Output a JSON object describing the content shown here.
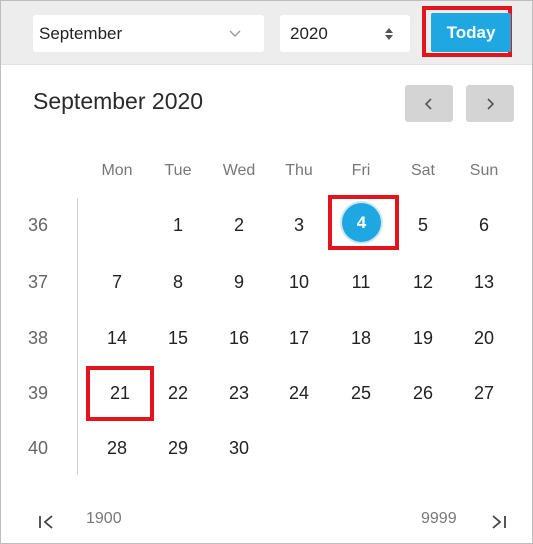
{
  "toolbar": {
    "month_value": "September",
    "year_value": "2020",
    "today_label": "Today"
  },
  "header": {
    "title": "September 2020"
  },
  "weekdays": [
    "Mon",
    "Tue",
    "Wed",
    "Thu",
    "Fri",
    "Sat",
    "Sun"
  ],
  "weeks": [
    {
      "number": "36",
      "days": [
        "",
        "1",
        "2",
        "3",
        "4",
        "5",
        "6"
      ]
    },
    {
      "number": "37",
      "days": [
        "7",
        "8",
        "9",
        "10",
        "11",
        "12",
        "13"
      ]
    },
    {
      "number": "38",
      "days": [
        "14",
        "15",
        "16",
        "17",
        "18",
        "19",
        "20"
      ]
    },
    {
      "number": "39",
      "days": [
        "21",
        "22",
        "23",
        "24",
        "25",
        "26",
        "27"
      ]
    },
    {
      "number": "40",
      "days": [
        "28",
        "29",
        "30",
        "",
        "",
        "",
        ""
      ]
    }
  ],
  "selected_day": "4",
  "today_day": "21",
  "footer": {
    "min_year": "1900",
    "max_year": "9999"
  },
  "colors": {
    "accent": "#1ea7e1",
    "highlight_border": "#e3141b",
    "toolbar_bg": "#ededed",
    "nav_button_bg": "#d4d4d4"
  },
  "icons": {
    "month_dropdown": "chevron-down-icon",
    "year_spinner": "spinner-arrows-icon",
    "prev_month": "chevron-left-icon",
    "next_month": "chevron-right-icon",
    "first": "first-page-icon",
    "last": "last-page-icon"
  }
}
